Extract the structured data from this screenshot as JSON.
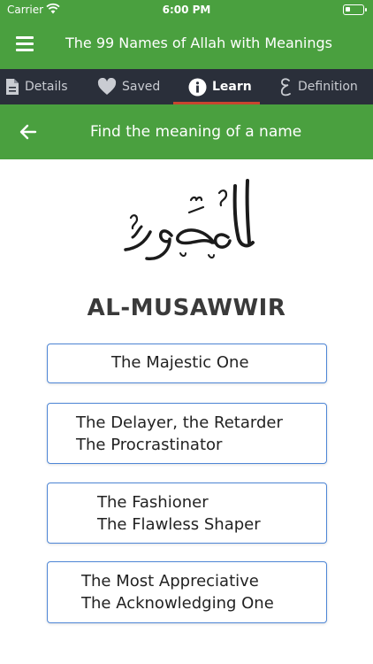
{
  "status_bar": {
    "carrier": "Carrier",
    "time": "6:00 PM"
  },
  "app_bar": {
    "title": "The 99 Names of Allah with Meanings"
  },
  "tabs": [
    {
      "label": "Details",
      "icon": "document-icon"
    },
    {
      "label": "Saved",
      "icon": "heart-icon"
    },
    {
      "label": "Learn",
      "icon": "info-icon",
      "active": true
    },
    {
      "label": "Definition",
      "icon": "arabic-letter-icon"
    }
  ],
  "subheader": {
    "title": "Find the meaning of a name"
  },
  "name": {
    "transliteration": "AL-MUSAWWIR",
    "arabic": "المُصَوِّرُ"
  },
  "options": [
    {
      "line1": "The Majestic One",
      "line2": ""
    },
    {
      "line1": "The Delayer, the Retarder",
      "line2": "The Procrastinator"
    },
    {
      "line1": "The Fashioner",
      "line2": "The Flawless Shaper"
    },
    {
      "line1": "The Most Appreciative",
      "line2": "The Acknowledging One"
    }
  ],
  "colors": {
    "primary_green": "#4aa03f",
    "tab_bar": "#2a2f3a",
    "tab_indicator": "#c8452f",
    "option_border": "#4e86d6"
  }
}
